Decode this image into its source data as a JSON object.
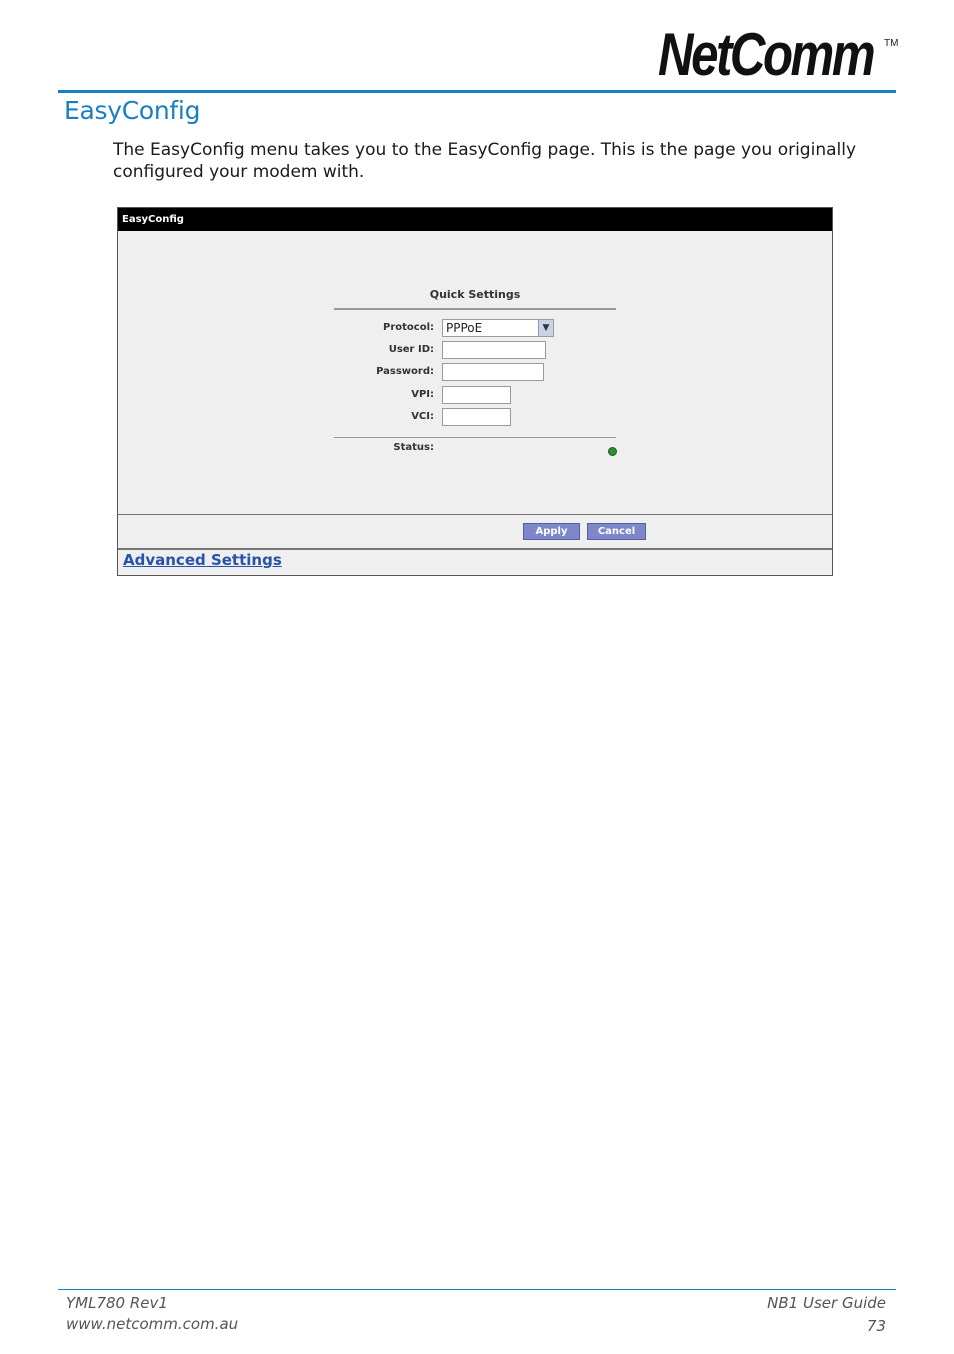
{
  "brand": {
    "logo_text": "NetComm",
    "trademark": "TM"
  },
  "section_title": "EasyConfig",
  "intro_text": "The EasyConfig menu takes you to the EasyConfig page. This is the page you originally configured your modem with.",
  "screenshot": {
    "header_title": "EasyConfig",
    "quick_settings_title": "Quick Settings",
    "fields": {
      "protocol": {
        "label": "Protocol:",
        "value": "PPPoE"
      },
      "user_id": {
        "label": "User ID:",
        "value": ""
      },
      "password": {
        "label": "Password:",
        "value": ""
      },
      "vpi": {
        "label": "VPI:",
        "value": ""
      },
      "vci": {
        "label": "VCI:",
        "value": ""
      }
    },
    "status_label": "Status:",
    "status_color": "#2f8f2f",
    "apply_label": "Apply",
    "cancel_label": "Cancel",
    "advanced_link": "Advanced Settings"
  },
  "footer": {
    "doc_code": "YML780 Rev1",
    "website": "www.netcomm.com.au",
    "guide_title": "NB1 User Guide",
    "page_number": "73"
  },
  "colors": {
    "accent": "#1a7fc1",
    "button": "#7d87c9",
    "link": "#2a52a8"
  }
}
